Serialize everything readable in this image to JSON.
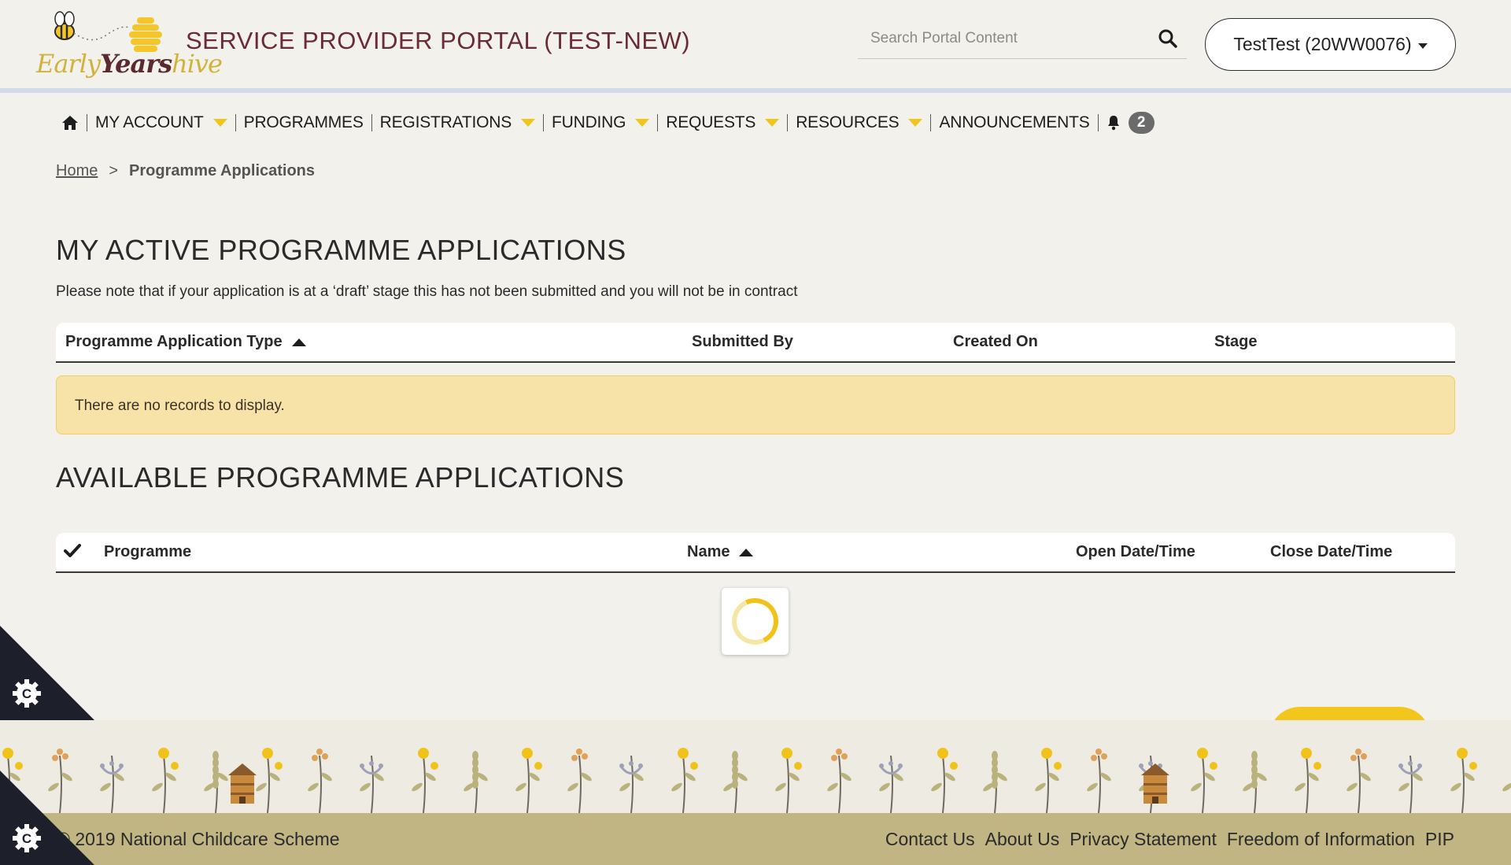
{
  "header": {
    "logo": {
      "word1": "Early",
      "word2": "Years",
      "word3": "hive"
    },
    "portal_title": "SERVICE PROVIDER PORTAL (TEST-NEW)",
    "search": {
      "placeholder": "Search Portal Content",
      "value": ""
    },
    "search_icon": "search-icon",
    "user_label": "TestTest (20WW0076)"
  },
  "nav": {
    "home_icon": "home-icon",
    "items": [
      {
        "label": "MY ACCOUNT",
        "has_dropdown": true
      },
      {
        "label": "PROGRAMMES",
        "has_dropdown": false
      },
      {
        "label": "REGISTRATIONS",
        "has_dropdown": true
      },
      {
        "label": "FUNDING",
        "has_dropdown": true
      },
      {
        "label": "REQUESTS",
        "has_dropdown": true
      },
      {
        "label": "RESOURCES",
        "has_dropdown": true
      },
      {
        "label": "ANNOUNCEMENTS",
        "has_dropdown": false
      }
    ],
    "notifications_icon": "bell-icon",
    "notification_count": "2"
  },
  "breadcrumb": {
    "home": "Home",
    "separator": ">",
    "current": "Programme Applications"
  },
  "active_section": {
    "title": "MY ACTIVE PROGRAMME APPLICATIONS",
    "note": "Please note that if your application is at a ‘draft’ stage this has not been submitted and you will not be in contract",
    "columns": [
      "Programme Application Type",
      "Submitted By",
      "Created On",
      "Stage"
    ],
    "sorted_column": "Programme Application Type",
    "empty_message": "There are no records to display."
  },
  "available_section": {
    "title": "AVAILABLE PROGRAMME APPLICATIONS",
    "columns": [
      "Programme",
      "Name",
      "Open Date/Time",
      "Close Date/Time"
    ],
    "select_all_icon": "checkmark-icon",
    "sorted_column": "Name",
    "loading": true
  },
  "footer": {
    "copyright": "© 2019 National Childcare Scheme",
    "links": [
      "Contact Us",
      "About Us",
      "Privacy Statement",
      "Freedom of Information",
      "PIP"
    ]
  },
  "cookie_icon": "cookie-settings-icon",
  "colors": {
    "background": "#f3f1ec",
    "brand_maroon": "#6a2b34",
    "accent_yellow": "#f1c31a",
    "notice_bg": "#f7e3a8",
    "footer_bar": "#c1b584",
    "cookie_corner": "#1d1f2b"
  }
}
